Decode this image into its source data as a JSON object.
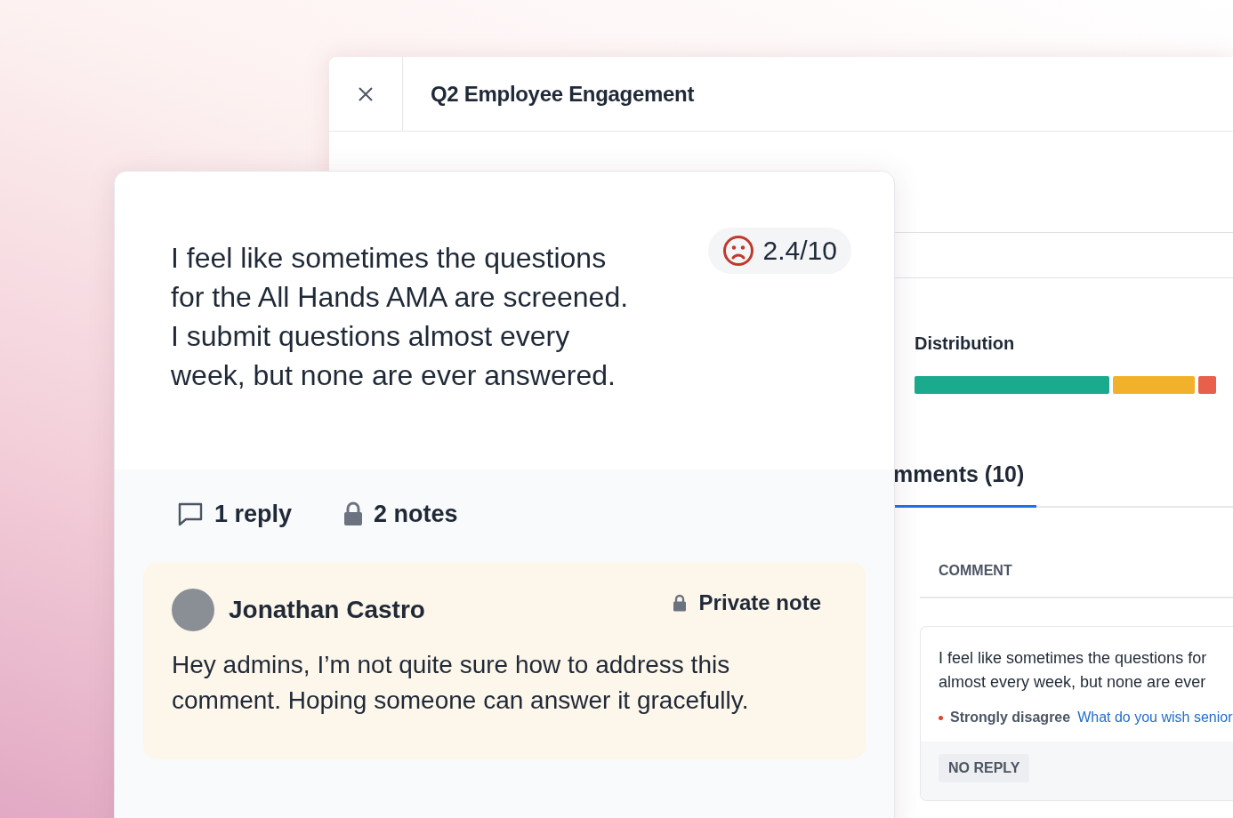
{
  "survey_window": {
    "title": "Q2 Employee Engagement",
    "distribution": {
      "title": "Distribution"
    },
    "tabs": [
      {
        "label": "mments (10)",
        "selected": true
      }
    ],
    "column_header": "COMMENT",
    "comment_card": {
      "lines": [
        "I feel like sometimes the questions for",
        "almost every week, but none are ever"
      ],
      "answer": "Strongly disagree",
      "color": "#e0452f",
      "question": "What do you wish senior",
      "reply_status": "NO REPLY"
    }
  },
  "comment_detail": {
    "text_lines": [
      "I feel like sometimes the questions",
      "for the All Hands AMA are screened.",
      "I submit questions almost every",
      "week, but none are ever answered."
    ],
    "score": "2.4/10",
    "replies": "1 reply",
    "notes": "2 notes",
    "note": {
      "author": "Jonathan Castro",
      "visibility": "Private note",
      "text": "Hey admins, I’m not quite sure how to address this comment. Hoping someone can answer it gracefully."
    }
  }
}
